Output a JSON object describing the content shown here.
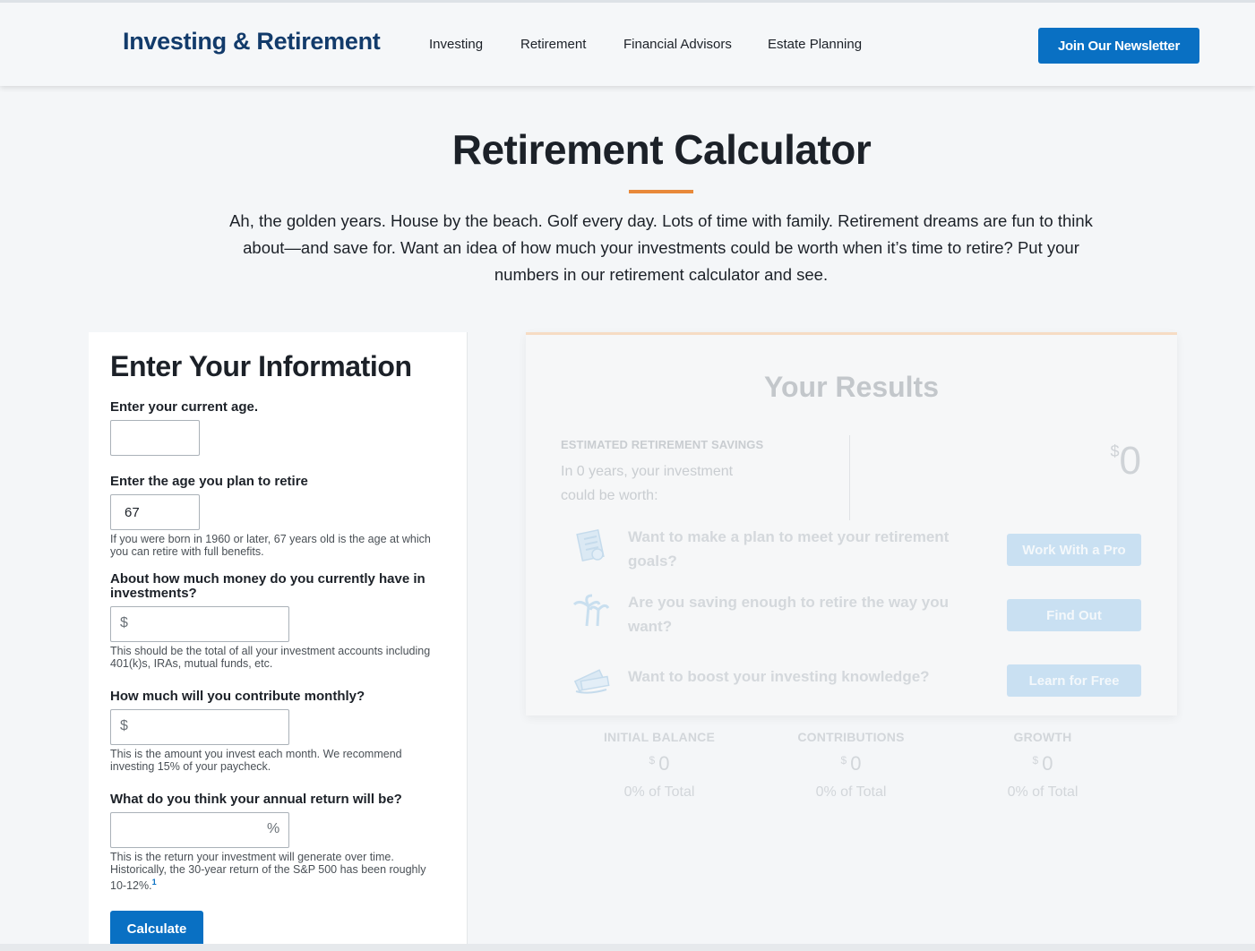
{
  "header": {
    "brand": "Investing & Retirement",
    "nav": [
      "Investing",
      "Retirement",
      "Financial Advisors",
      "Estate Planning"
    ],
    "newsletter_label": "Join Our Newsletter"
  },
  "hero": {
    "title": "Retirement Calculator",
    "intro": "Ah, the golden years. House by the beach. Golf every day. Lots of time with family. Retirement dreams are fun to think about—and save for. Want an idea of how much your investments could be worth when it’s time to retire? Put your numbers in our retirement calculator and see."
  },
  "form": {
    "heading": "Enter Your Information",
    "current_age": {
      "label": "Enter your current age.",
      "value": ""
    },
    "retire_age": {
      "label": "Enter the age you plan to retire",
      "value": "67",
      "hint": "If you were born in 1960 or later, 67 years old is the age at which you can retire with full benefits."
    },
    "investments": {
      "label": "About how much money do you currently have in investments?",
      "prefix": "$",
      "value": "",
      "hint": "This should be the total of all your investment accounts including 401(k)s, IRAs, mutual funds, etc."
    },
    "monthly": {
      "label": "How much will you contribute monthly?",
      "prefix": "$",
      "value": "",
      "hint": "This is the amount you invest each month. We recommend investing 15% of your paycheck."
    },
    "annual_return": {
      "label": "What do you think your annual return will be?",
      "suffix": "%",
      "value": "",
      "hint": "This is the return your investment will generate over time. Historically, the 30-year return of the S&P 500 has been roughly 10-12%.",
      "footnote": "1"
    },
    "calculate_label": "Calculate"
  },
  "results": {
    "title": "Your Results",
    "estimated_label": "ESTIMATED RETIREMENT SAVINGS",
    "estimated_sub": "In 0 years, your investment could be worth:",
    "currency": "$",
    "estimated_value": "0",
    "ctas": [
      {
        "icon": "checklist-icon",
        "text": "Want to make a plan to meet your retirement goals?",
        "button": "Work With a Pro"
      },
      {
        "icon": "palm-trees-icon",
        "text": "Are you saving enough to retire the way you want?",
        "button": "Find Out"
      },
      {
        "icon": "money-stack-icon",
        "text": "Want to boost your investing knowledge?",
        "button": "Learn for Free"
      }
    ],
    "stats": [
      {
        "label": "INITIAL BALANCE",
        "value": "0",
        "pct": "0% of Total"
      },
      {
        "label": "CONTRIBUTIONS",
        "value": "0",
        "pct": "0% of Total"
      },
      {
        "label": "GROWTH",
        "value": "0",
        "pct": "0% of Total"
      }
    ]
  },
  "colors": {
    "brand_navy": "#123b6b",
    "primary_blue": "#0970c3",
    "accent_orange": "#e8893a"
  }
}
